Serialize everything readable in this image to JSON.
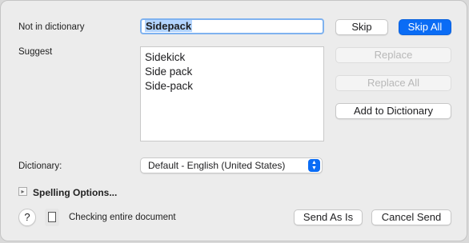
{
  "labels": {
    "not_in_dictionary": "Not in dictionary",
    "suggest": "Suggest",
    "dictionary": "Dictionary:",
    "spelling_options": "Spelling Options...",
    "status": "Checking entire document"
  },
  "word": "Sidepack",
  "suggestions": [
    "Sidekick",
    "Side pack",
    "Side-pack"
  ],
  "buttons": {
    "skip": "Skip",
    "skip_all": "Skip All",
    "replace": "Replace",
    "replace_all": "Replace All",
    "add_to_dictionary": "Add to Dictionary",
    "send_as_is": "Send As Is",
    "cancel_send": "Cancel Send",
    "help": "?"
  },
  "dictionary_select": {
    "selected": "Default - English (United States)"
  },
  "colors": {
    "accent": "#0a6cf5",
    "selection": "#b3d4fe",
    "focus_ring": "#7fb2ef"
  },
  "icons": {
    "help": "question-mark-icon",
    "document": "document-icon",
    "disclosure": "disclosure-triangle-icon",
    "select_arrows": "up-down-chevron-icon"
  }
}
